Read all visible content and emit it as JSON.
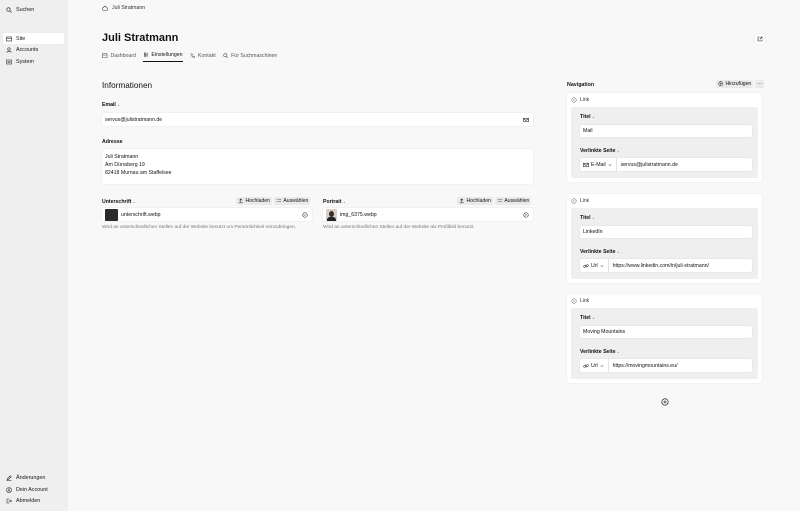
{
  "sidebar": {
    "search": "Suchen",
    "items": [
      {
        "label": "Site"
      },
      {
        "label": "Accounts"
      },
      {
        "label": "System"
      }
    ],
    "bottom": [
      {
        "label": "Änderungen"
      },
      {
        "label": "Dein Account"
      },
      {
        "label": "Abmelden"
      }
    ]
  },
  "breadcrumb": "Juli Stratmann",
  "page": {
    "title": "Juli Stratmann",
    "tabs": [
      {
        "label": "Dashboard"
      },
      {
        "label": "Einstellungen"
      },
      {
        "label": "Kontakt"
      },
      {
        "label": "Für Suchmaschinen"
      }
    ]
  },
  "info": {
    "title": "Informationen",
    "email_label": "Email",
    "email_value": "servus@julistratmann.de",
    "address_label": "Adresse",
    "address_lines": [
      "Juli Stratmann",
      "Am Dürraberg 19",
      "82418 Murnau am Staffelsee"
    ],
    "signature": {
      "label": "Unterschrift",
      "upload": "Hochladen",
      "select": "Auswählen",
      "file": "unterschrift.webp",
      "help": "Wird an unterschiedlichen Stellen auf der Website benutzt um Persönlichkeit reinzubringen."
    },
    "portrait": {
      "label": "Portrait",
      "upload": "Hochladen",
      "select": "Auswählen",
      "file": "img_6375.webp",
      "help": "Wird an unterschiedlichen Stellen auf der Website als Profilbild benutzt."
    }
  },
  "navigation": {
    "title": "Navigation",
    "add_label": "Hinzufügen",
    "more": "···",
    "items": [
      {
        "head": "Link",
        "title_label": "Titel",
        "title_value": "Mail",
        "page_label": "Verlinkte Seite",
        "link_type": "E-Mail",
        "link_value": "servus@julistratmann.de"
      },
      {
        "head": "Link",
        "title_label": "Titel",
        "title_value": "LinkedIn",
        "page_label": "Verlinkte Seite",
        "link_type": "Url",
        "link_value": "https://www.linkedin.com/in/juli-stratmann/"
      },
      {
        "head": "Link",
        "title_label": "Titel",
        "title_value": "Moving Mountains",
        "page_label": "Verlinkte Seite",
        "link_type": "Url",
        "link_value": "https://movingmountains.eu/"
      }
    ]
  },
  "colors": {
    "sidebar_bg": "#efefef",
    "main_bg": "#f8f8f8",
    "card_bg": "#ffffff"
  }
}
